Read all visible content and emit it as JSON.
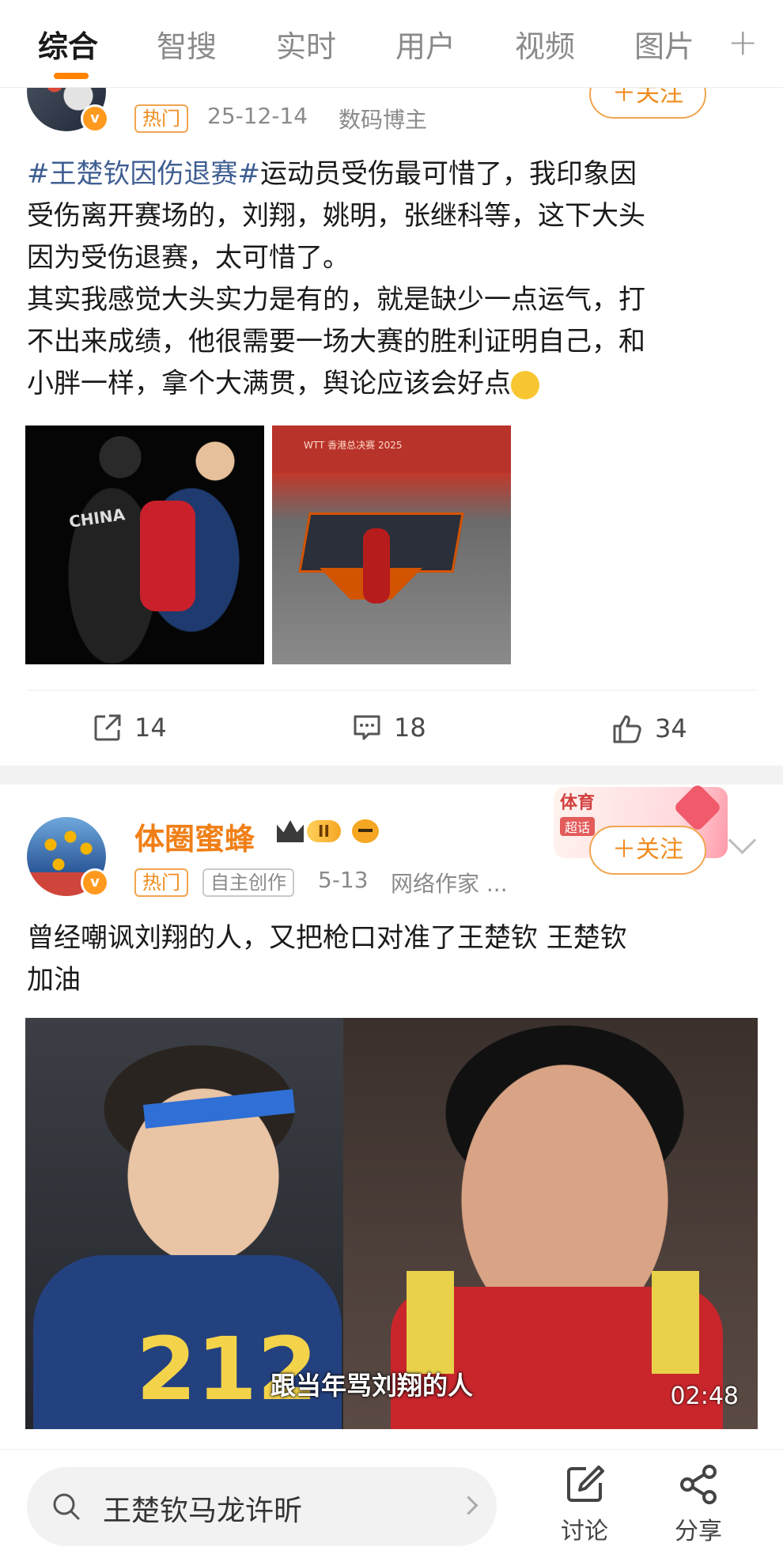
{
  "tabs": [
    "综合",
    "智搜",
    "实时",
    "用户",
    "视频",
    "图片"
  ],
  "add_tab_icon": "plus-icon",
  "accent_color": "#ff8200",
  "post1": {
    "hot_label": "热门",
    "date": "25-12-14",
    "source": "数码博主",
    "follow_label": "＋关注",
    "hashtag": "#王楚钦因伤退赛#",
    "text_line1_rest": "运动员受伤最可惜了，我印象因",
    "text_line2": "受伤离开赛场的，刘翔，姚明，张继科等，这下大头",
    "text_line3": "因为受伤退赛，太可惜了。",
    "text_line4": "其实我感觉大头实力是有的，就是缺少一点运气，打",
    "text_line5": "不出来成绩，他很需要一场大赛的胜利证明自己，和",
    "text_line6": "小胖一样，拿个大满贯，舆论应该会好点",
    "image1_text": "CHINA",
    "image2_text": "WTT 香港总决赛 2025",
    "repost_count": "14",
    "comment_count": "18",
    "like_count": "34"
  },
  "post2": {
    "username": "体圈蜜蜂",
    "level": "II",
    "promo_title": "体育",
    "promo_sub": "超话",
    "follow_label": "＋关注",
    "hot_label": "热门",
    "original_label": "自主创作",
    "date": "5-13",
    "source": "网络作家 ...",
    "text_line1": "曾经嘲讽刘翔的人，又把枪口对准了王楚钦 王楚钦",
    "text_line2": "加油",
    "jersey_text": "212",
    "video_subtitle": "跟当年骂刘翔的人",
    "duration": "02:48"
  },
  "bottom": {
    "search_query": "王楚钦马龙许昕",
    "discuss_label": "讨论",
    "share_label": "分享"
  }
}
